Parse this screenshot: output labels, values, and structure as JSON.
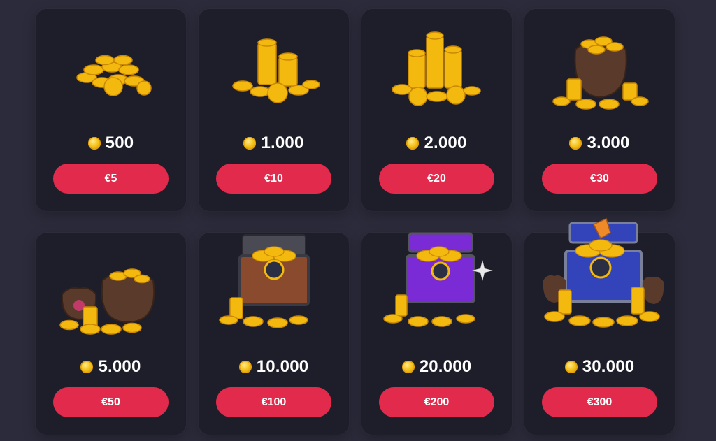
{
  "accent_color": "#e22b4c",
  "packages": [
    {
      "art": "coin-pile-icon",
      "amount": "500",
      "price": "€5"
    },
    {
      "art": "coin-stacks-icon",
      "amount": "1.000",
      "price": "€10"
    },
    {
      "art": "coin-tower-icon",
      "amount": "2.000",
      "price": "€20"
    },
    {
      "art": "coin-sack-icon",
      "amount": "3.000",
      "price": "€30"
    },
    {
      "art": "coin-bags-icon",
      "amount": "5.000",
      "price": "€50"
    },
    {
      "art": "wooden-chest-icon",
      "amount": "10.000",
      "price": "€100"
    },
    {
      "art": "purple-chest-icon",
      "amount": "20.000",
      "price": "€200"
    },
    {
      "art": "blue-chest-icon",
      "amount": "30.000",
      "price": "€300"
    }
  ]
}
